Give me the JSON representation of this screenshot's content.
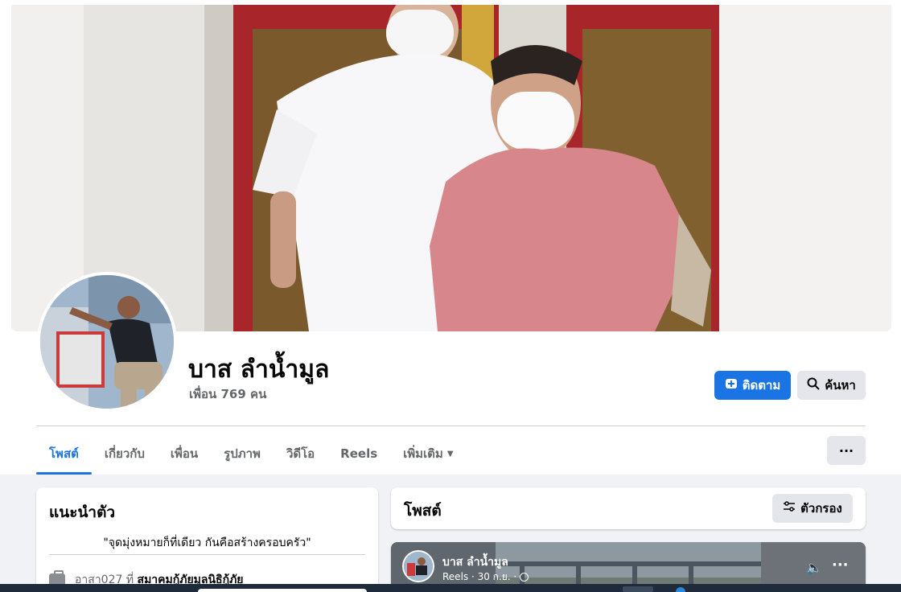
{
  "profile": {
    "name": "บาส ลำน้ำมูล",
    "friends": "เพื่อน 769 คน"
  },
  "actions": {
    "follow_label": "ติดตาม",
    "search_label": "ค้นหา",
    "more_label": "···"
  },
  "tabs": [
    {
      "label": "โพสต์",
      "active": true
    },
    {
      "label": "เกี่ยวกับ",
      "active": false
    },
    {
      "label": "เพื่อน",
      "active": false
    },
    {
      "label": "รูปภาพ",
      "active": false
    },
    {
      "label": "วิดีโอ",
      "active": false
    },
    {
      "label": "Reels",
      "active": false
    },
    {
      "label": "เพิ่มเติม",
      "active": false
    }
  ],
  "intro": {
    "title": "แนะนำตัว",
    "bio": "\"จุดมุ่งหมายก็ที่เดียว กันคือสร้างครอบครัว\"",
    "work_prefix": "อาสา027 ที่",
    "work_place": "สมาคมกู้ภัยมูลนิธิกู้ภัย"
  },
  "posts": {
    "title": "โพสต์",
    "filter_label": "ตัวกรอง"
  },
  "reel": {
    "author": "บาส ลำน้ำมูล",
    "meta": "Reels · 30 ก.ย. ·"
  },
  "colors": {
    "accent": "#1b74e4",
    "background": "#f0f2f5",
    "secondary_text": "#65676b"
  },
  "icons": {
    "follow": "follow-plus-icon",
    "search": "magnifier-icon",
    "filter": "sliders-icon",
    "mute": "speaker-muted-icon"
  }
}
